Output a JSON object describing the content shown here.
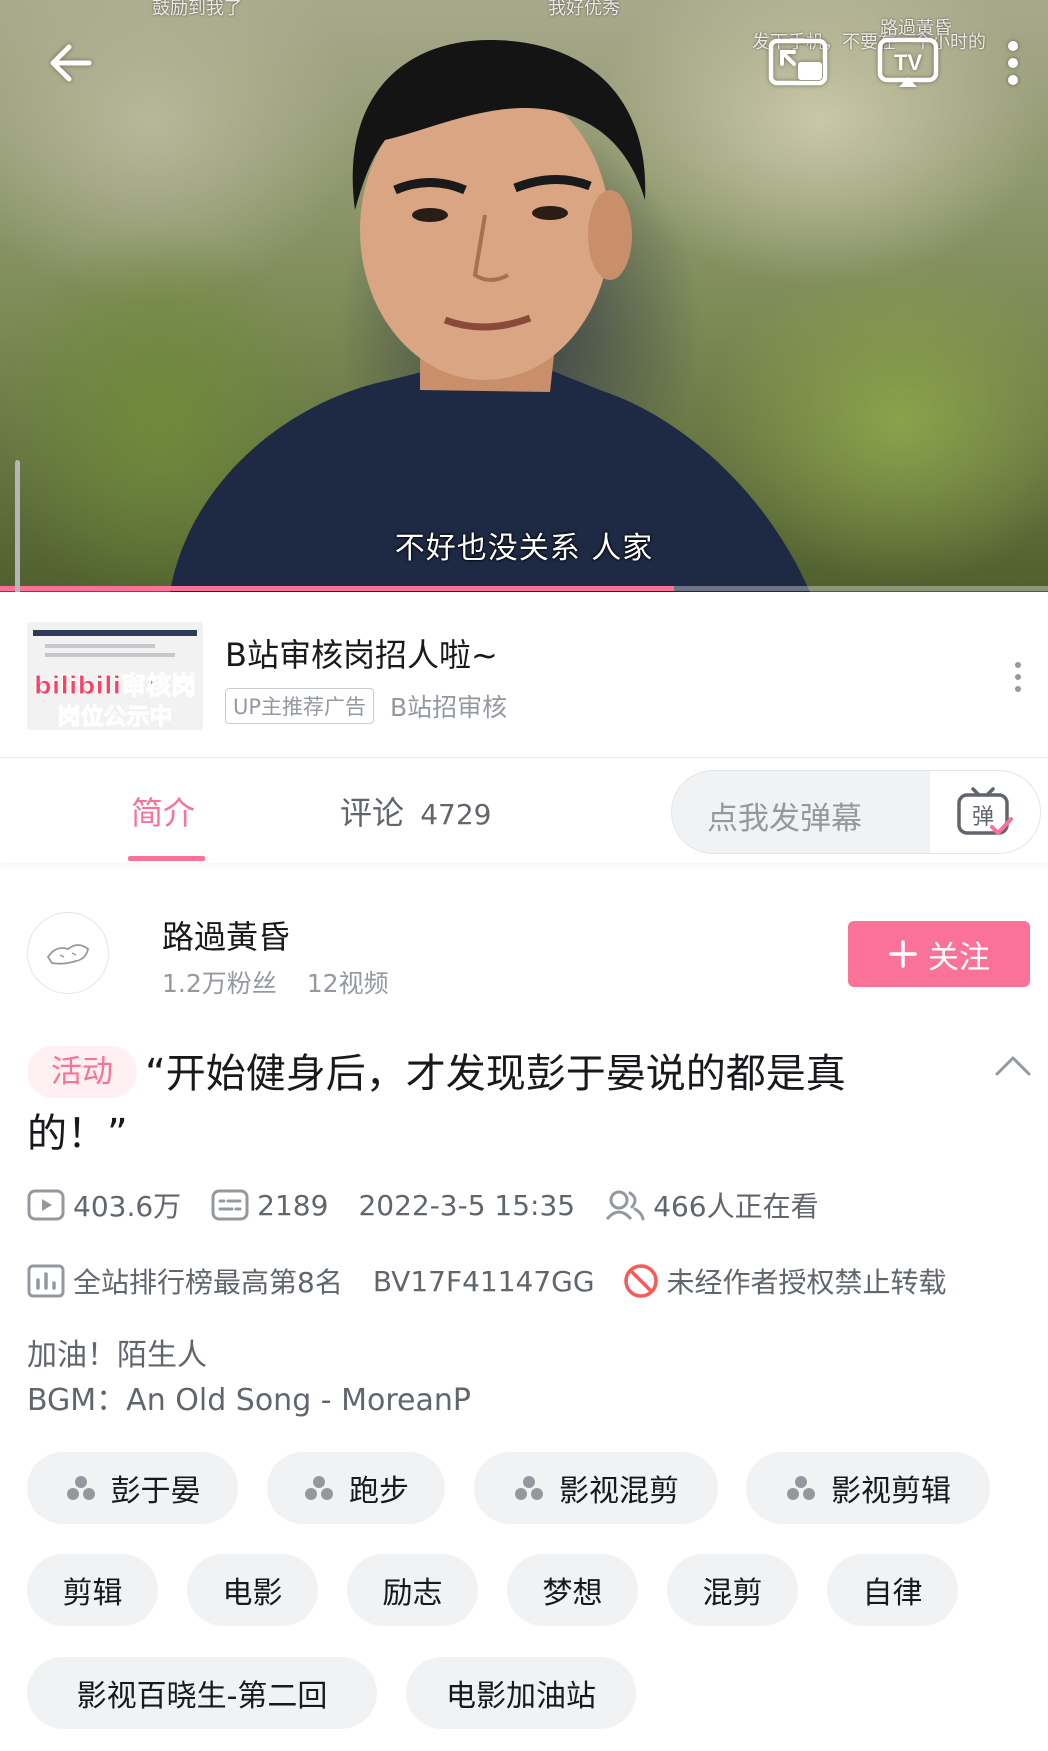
{
  "player": {
    "subtitle": "不好也没关系 人家",
    "danmaku": [
      "鼓励到我了",
      "我好优秀",
      "发下手机，不要在一个小时的",
      "路過黃昏"
    ],
    "progress": 0.643
  },
  "icons": {
    "back": "back-arrow-icon",
    "pip": "picture-in-picture-icon",
    "tv": "tv-cast-icon",
    "more": "more-vertical-icon"
  },
  "ad": {
    "thumb_line1": "bilibili审核岗",
    "thumb_line2": "岗位公示中",
    "title": "B站审核岗招人啦~",
    "badge": "UP主推荐广告",
    "source": "B站招审核"
  },
  "tabs": {
    "intro": "简介",
    "comments": "评论",
    "comments_count": "4729",
    "danmaku_placeholder": "点我发弹幕",
    "danmaku_btn": "弹"
  },
  "uploader": {
    "name": "路過黃昏",
    "fans": "1.2万粉丝",
    "videos": "12视频",
    "follow": "关注"
  },
  "video": {
    "activity_tag": "活动",
    "title": "“开始健身后，才发现彭于晏说的都是真的！”",
    "views": "403.6万",
    "danmaku_count": "2189",
    "date": "2022-3-5 15:35",
    "watching": "466人正在看",
    "rank": "全站排行榜最高第8名",
    "bvid": "BV17F41147GG",
    "copyright": "未经作者授权禁止转载",
    "desc_line1": "加油！陌生人",
    "desc_line2": "BGM：An Old Song - MoreanP"
  },
  "tags": {
    "topic": [
      "彭于晏",
      "跑步",
      "影视混剪",
      "影视剪辑"
    ],
    "plain": [
      "剪辑",
      "电影",
      "励志",
      "梦想",
      "混剪",
      "自律"
    ],
    "wide": [
      "影视百晓生-第二回",
      "电影加油站"
    ]
  },
  "colors": {
    "accent": "#fb7299",
    "text_primary": "#18191c",
    "text_secondary": "#61666d",
    "text_tertiary": "#9499a0",
    "tag_bg": "#f1f2f3",
    "warning_red": "#f25d59"
  }
}
